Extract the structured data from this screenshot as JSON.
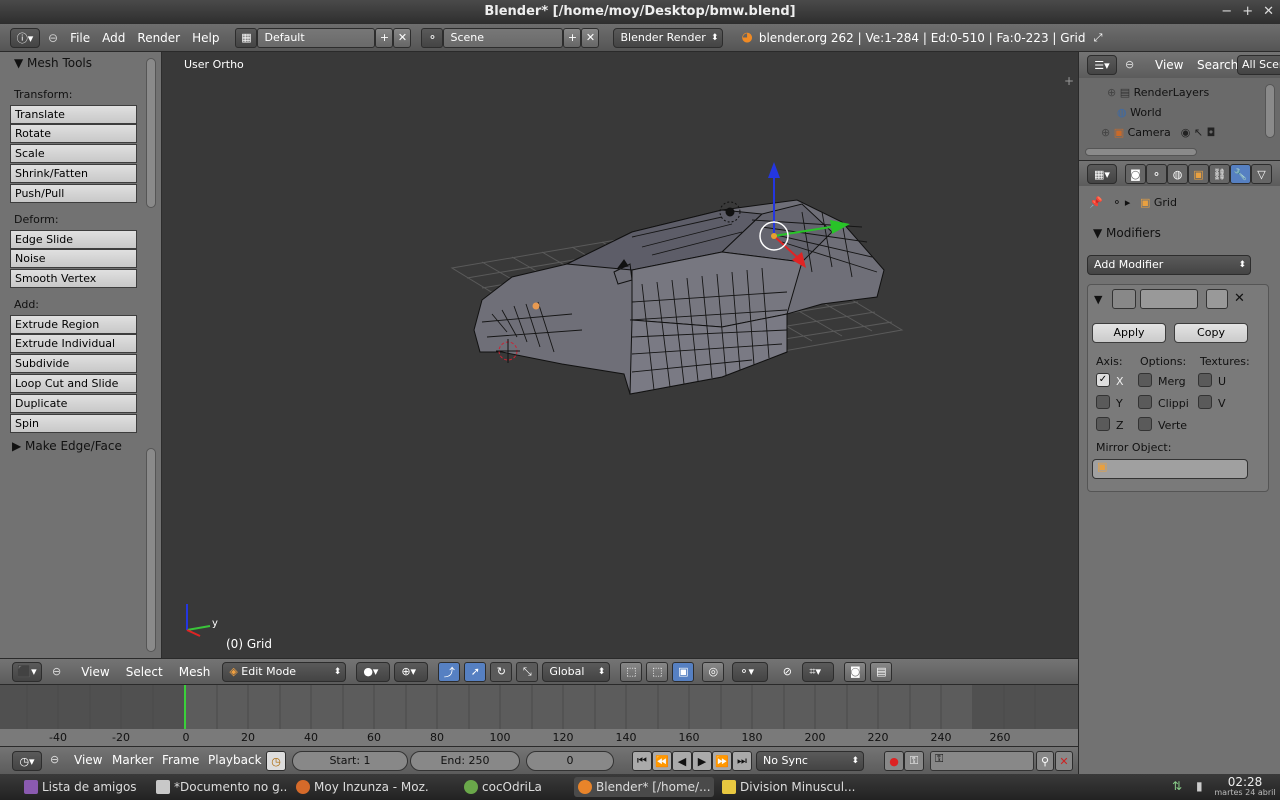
{
  "window": {
    "title": "Blender* [/home/moy/Desktop/bmw.blend]",
    "controls": [
      "−",
      "+",
      "✕"
    ]
  },
  "info_header": {
    "menus": [
      "File",
      "Add",
      "Render",
      "Help"
    ],
    "screen_layout": "Default",
    "scene": "Scene",
    "render_engine": "Blender Render",
    "stats": "blender.org 262 | Ve:1-284 | Ed:0-510 | Fa:0-223 | Grid"
  },
  "toolshelf": {
    "title": "Mesh Tools",
    "transform_label": "Transform:",
    "transform": [
      "Translate",
      "Rotate",
      "Scale",
      "Shrink/Fatten",
      "Push/Pull"
    ],
    "deform_label": "Deform:",
    "deform": [
      "Edge Slide",
      "Noise",
      "Smooth Vertex"
    ],
    "add_label": "Add:",
    "add": [
      "Extrude Region",
      "Extrude Individual",
      "Subdivide",
      "Loop Cut and Slide",
      "Duplicate",
      "Spin"
    ],
    "collapsed_panel": "Make Edge/Face"
  },
  "viewport": {
    "view_label": "User Ortho",
    "object_label": "(0) Grid",
    "axis_y": "y"
  },
  "view3d_header": {
    "menus": [
      "View",
      "Select",
      "Mesh"
    ],
    "mode": "Edit Mode",
    "orientation": "Global"
  },
  "timeline": {
    "ruler": [
      "-40",
      "-20",
      "0",
      "20",
      "40",
      "60",
      "80",
      "100",
      "120",
      "140",
      "160",
      "180",
      "200",
      "220",
      "240",
      "260"
    ],
    "current_frame_marker": 0,
    "menus": [
      "View",
      "Marker",
      "Frame",
      "Playback"
    ],
    "start": "Start: 1",
    "end": "End: 250",
    "current": "0",
    "sync": "No Sync"
  },
  "outliner": {
    "menus": [
      "View",
      "Search"
    ],
    "filter": "All Scen",
    "items": [
      "RenderLayers",
      "World",
      "Camera"
    ]
  },
  "properties": {
    "context_object": "Grid",
    "panel_title": "Modifiers",
    "add_modifier": "Add Modifier",
    "apply": "Apply",
    "copy": "Copy",
    "axis_label": "Axis:",
    "options_label": "Options:",
    "textures_label": "Textures:",
    "axis": [
      {
        "label": "X",
        "checked": true
      },
      {
        "label": "Y",
        "checked": false
      },
      {
        "label": "Z",
        "checked": false
      }
    ],
    "options": [
      {
        "label": "Merg",
        "checked": false
      },
      {
        "label": "Clippi",
        "checked": false
      },
      {
        "label": "Verte",
        "checked": false
      }
    ],
    "textures": [
      {
        "label": "U",
        "checked": false
      },
      {
        "label": "V",
        "checked": false
      }
    ],
    "mirror_object_label": "Mirror Object:"
  },
  "taskbar": {
    "tasks": [
      "Lista de amigos",
      "*Documento no g...",
      "Moy Inzunza - Moz...",
      "cocOdriLa",
      "Blender* [/home/...",
      "Division Minuscul..."
    ],
    "time": "02:28",
    "date": "martes 24 abril"
  },
  "colors": {
    "accent_blue": "#5680c2",
    "header_dark": "#2e2e2e",
    "panel_gray": "#727272"
  }
}
